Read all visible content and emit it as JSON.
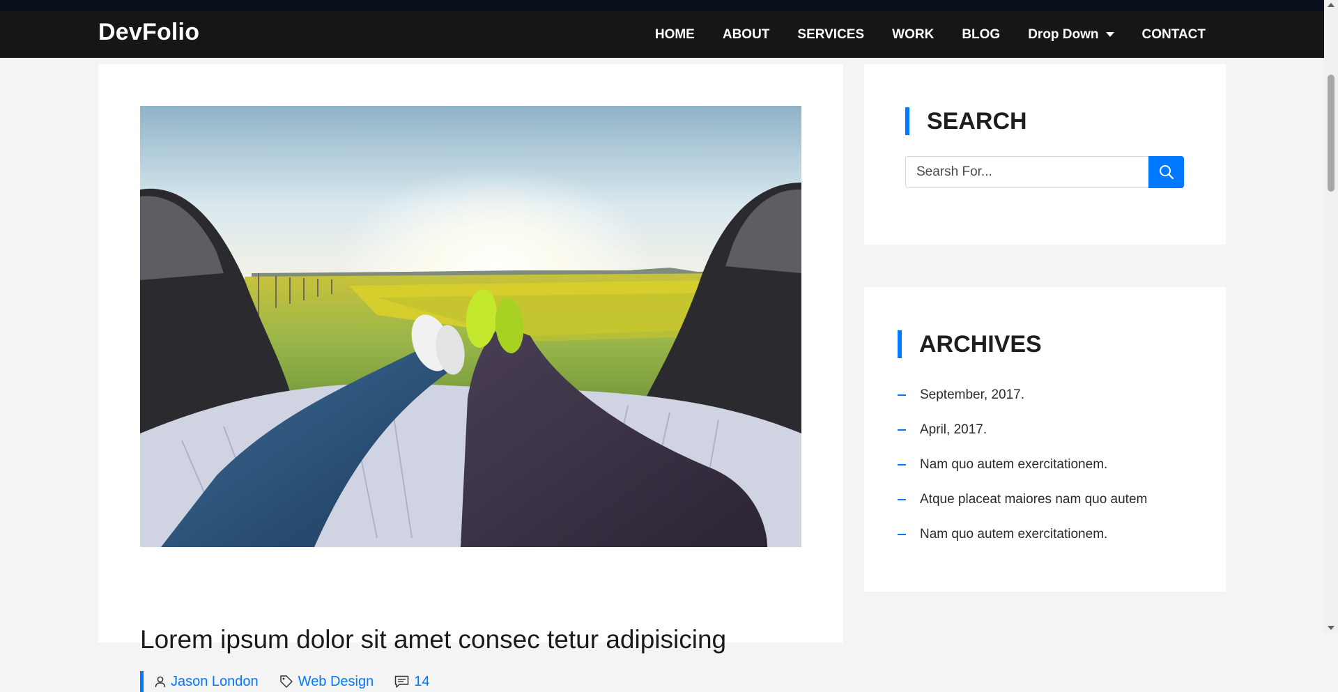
{
  "brand": "DevFolio",
  "nav": {
    "items": [
      "HOME",
      "ABOUT",
      "SERVICES",
      "WORK",
      "BLOG",
      "Drop Down",
      "CONTACT"
    ]
  },
  "post": {
    "title": "Lorem ipsum dolor sit amet consec tetur adipisicing",
    "author": "Jason London",
    "category": "Web Design",
    "comments": "14"
  },
  "sidebar": {
    "search": {
      "title": "SEARCH",
      "placeholder": "Searsh For..."
    },
    "archives": {
      "title": "ARCHIVES",
      "items": [
        "September, 2017.",
        "April, 2017.",
        "Nam quo autem exercitationem.",
        "Atque placeat maiores nam quo autem",
        "Nam quo autem exercitationem."
      ]
    }
  },
  "colors": {
    "accent": "#0078ff",
    "navbar": "#161616",
    "page_bg": "#f4f4f4"
  },
  "icons": [
    "chevron-down-icon",
    "user-icon",
    "tag-icon",
    "comment-icon",
    "search-icon"
  ]
}
